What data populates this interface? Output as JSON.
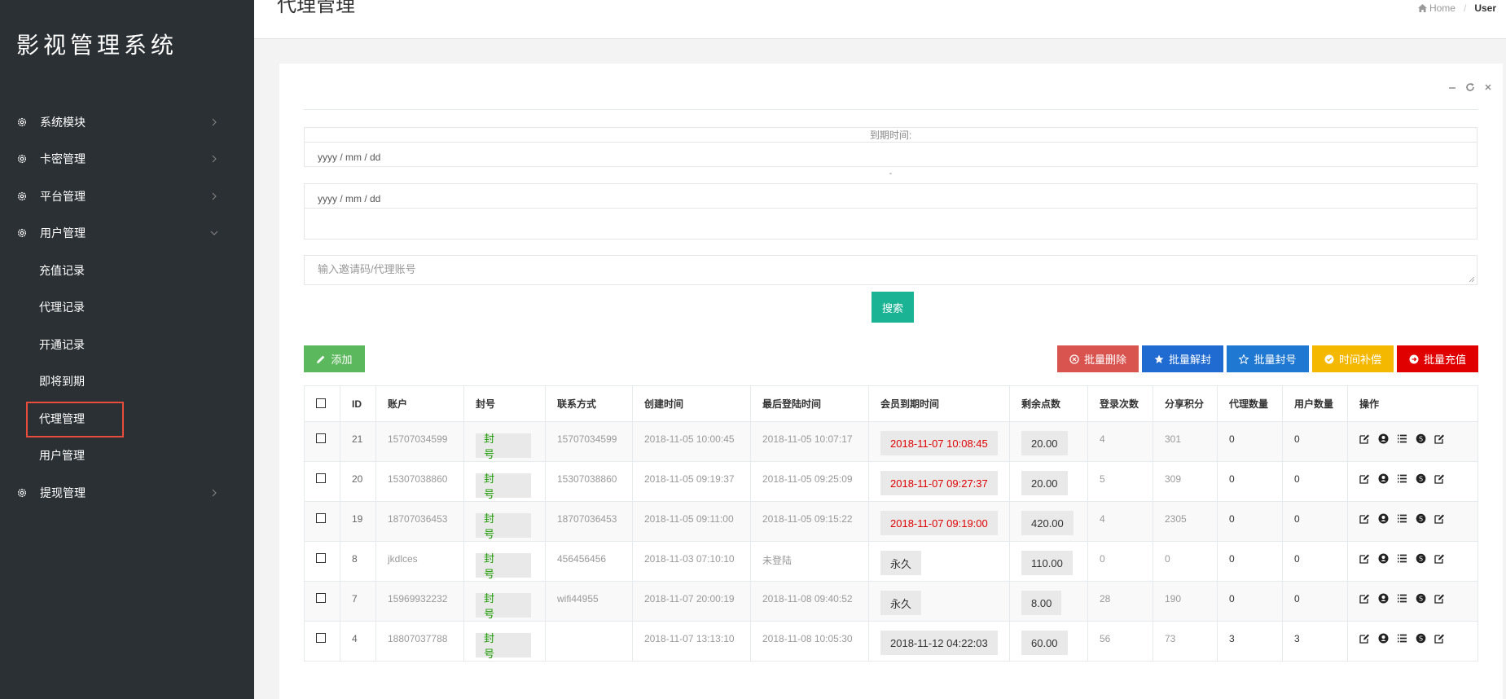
{
  "app": {
    "title": "影视管理系统"
  },
  "sidebar": {
    "items": [
      {
        "label": "系统模块"
      },
      {
        "label": "卡密管理"
      },
      {
        "label": "平台管理"
      },
      {
        "label": "用户管理"
      },
      {
        "label": "提现管理"
      }
    ],
    "submenu": [
      {
        "label": "充值记录"
      },
      {
        "label": "代理记录"
      },
      {
        "label": "开通记录"
      },
      {
        "label": "即将到期"
      },
      {
        "label": "代理管理"
      },
      {
        "label": "用户管理"
      }
    ]
  },
  "header": {
    "title": "代理管理",
    "breadcrumb_home": "Home",
    "breadcrumb_current": "User"
  },
  "filter": {
    "expire_label": "到期时间:",
    "date_start": "yyyy / mm / dd",
    "range_sep": "-",
    "date_end": "yyyy / mm / dd",
    "search_placeholder": "输入邀请码/代理账号",
    "search_button": "搜索"
  },
  "actions": {
    "add": "添加",
    "batch_delete": "批量删除",
    "batch_unban": "批量解封",
    "batch_ban": "批量封号",
    "time_compensate": "时间补偿",
    "batch_recharge": "批量充值"
  },
  "table": {
    "columns": [
      "ID",
      "账户",
      "封号",
      "联系方式",
      "创建时间",
      "最后登陆时间",
      "会员到期时间",
      "剩余点数",
      "登录次数",
      "分享积分",
      "代理数量",
      "用户数量",
      "操作"
    ],
    "ban_label": "封 号",
    "rows": [
      {
        "id": "21",
        "account": "15707034599",
        "contact": "15707034599",
        "created": "2018-11-05 10:00:45",
        "last_login": "2018-11-05 10:07:17",
        "expire": "2018-11-07 10:08:45",
        "expire_red": true,
        "points": "20.00",
        "logins": "4",
        "share": "301",
        "agents": "0",
        "users": "0"
      },
      {
        "id": "20",
        "account": "15307038860",
        "contact": "15307038860",
        "created": "2018-11-05 09:19:37",
        "last_login": "2018-11-05 09:25:09",
        "expire": "2018-11-07 09:27:37",
        "expire_red": true,
        "points": "20.00",
        "logins": "5",
        "share": "309",
        "agents": "0",
        "users": "0"
      },
      {
        "id": "19",
        "account": "18707036453",
        "contact": "18707036453",
        "created": "2018-11-05 09:11:00",
        "last_login": "2018-11-05 09:15:22",
        "expire": "2018-11-07 09:19:00",
        "expire_red": true,
        "points": "420.00",
        "logins": "4",
        "share": "2305",
        "agents": "0",
        "users": "0"
      },
      {
        "id": "8",
        "account": "jkdlces",
        "contact": "456456456",
        "created": "2018-11-03 07:10:10",
        "last_login": "未登陆",
        "expire": "永久",
        "expire_red": false,
        "points": "110.00",
        "logins": "0",
        "share": "0",
        "agents": "0",
        "users": "0"
      },
      {
        "id": "7",
        "account": "15969932232",
        "contact": "wifi44955",
        "created": "2018-11-07 20:00:19",
        "last_login": "2018-11-08 09:40:52",
        "expire": "永久",
        "expire_red": false,
        "points": "8.00",
        "logins": "28",
        "share": "190",
        "agents": "0",
        "users": "0"
      },
      {
        "id": "4",
        "account": "18807037788",
        "contact": "",
        "created": "2018-11-07 13:13:10",
        "last_login": "2018-11-08 10:05:30",
        "expire": "2018-11-12 04:22:03",
        "expire_red": false,
        "points": "60.00",
        "logins": "56",
        "share": "73",
        "agents": "3",
        "users": "3"
      }
    ]
  },
  "colors": {
    "sidebar_bg": "#2b3035",
    "primary_green": "#1ab394",
    "danger": "#d9534f",
    "blue": "#1f6bd1",
    "warning": "#f5b800",
    "red": "#e10000"
  }
}
